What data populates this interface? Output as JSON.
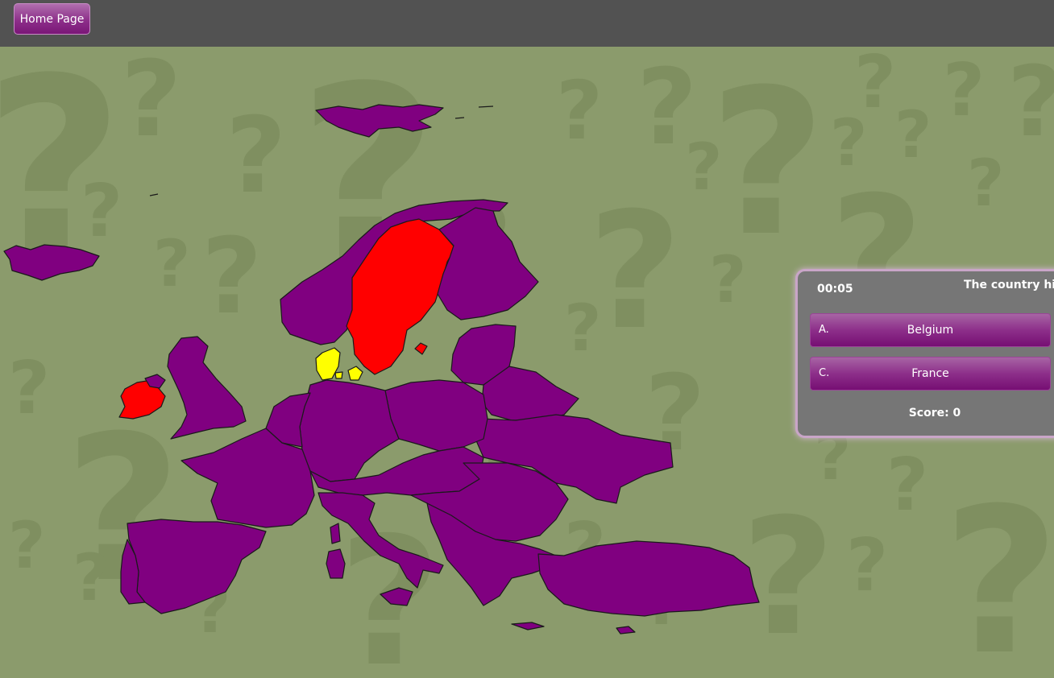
{
  "nav": {
    "home_label": "Home Page"
  },
  "quiz": {
    "timer": "00:05",
    "question": "The country hig",
    "answers": [
      {
        "letter": "A.",
        "text": "Belgium"
      },
      {
        "letter": "C.",
        "text": "France"
      }
    ],
    "score": "Score: 0"
  },
  "map": {
    "default_color": "#800080",
    "wrong_color": "#ff0000",
    "highlight_color": "#ffff00",
    "wrong_countries": [
      "Sweden",
      "Ireland"
    ],
    "highlighted_country": "Denmark"
  },
  "colors": {
    "background": "#8b9b6c",
    "topbar": "#525252",
    "panel": "#767676"
  }
}
